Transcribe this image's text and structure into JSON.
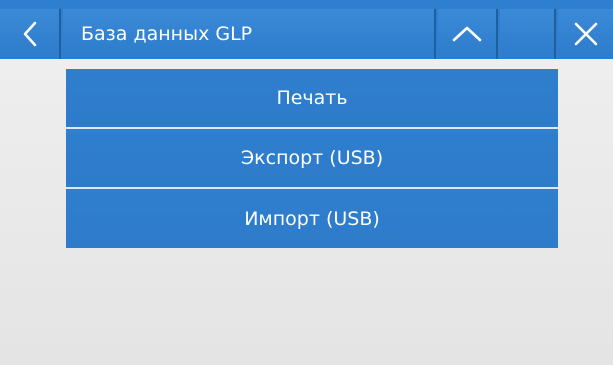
{
  "header": {
    "title": "База данных GLP",
    "back_icon": "chevron-left-icon",
    "up_icon": "chevron-up-icon",
    "close_icon": "close-icon"
  },
  "menu": {
    "items": [
      {
        "label": "Печать"
      },
      {
        "label": "Экспорт (USB)"
      },
      {
        "label": "Импорт (USB)"
      }
    ]
  },
  "colors": {
    "accent": "#2f7fd0",
    "background": "#ebebeb",
    "text": "#ffffff"
  }
}
